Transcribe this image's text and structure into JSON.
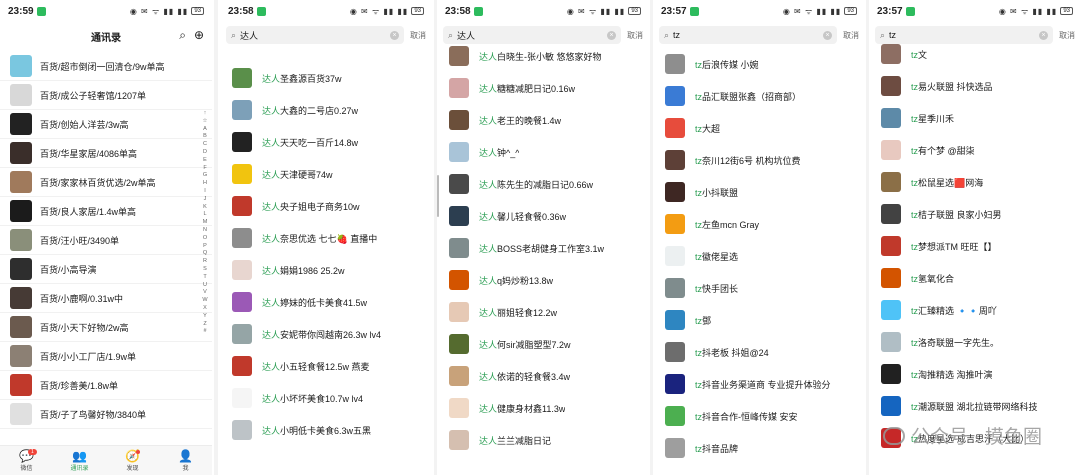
{
  "screens": [
    {
      "status": {
        "time": "23:59",
        "icons": "◉ ✉ ᯤ ▮▮ ▮▮",
        "battery": "93"
      },
      "header": {
        "title": "通讯录"
      },
      "rows": [
        {
          "label": "百货/超市倒闭一回清仓/9w单高",
          "color": "#7ac7e0"
        },
        {
          "label": "百货/成公子轻奢馆/1207单",
          "color": "#d8d8d8"
        },
        {
          "label": "百货/创始人洋芸/3w高",
          "color": "#222222"
        },
        {
          "label": "百货/华星家居/4086单高",
          "color": "#3a2e2a"
        },
        {
          "label": "百货/家家林百货优选/2w单高",
          "color": "#a07a5c"
        },
        {
          "label": "百货/良人家居/1.4w单高",
          "color": "#1b1b1b"
        },
        {
          "label": "百货/汪小旺/3490单",
          "color": "#8a8f7a"
        },
        {
          "label": "百货/小高导演",
          "color": "#2e2e2e"
        },
        {
          "label": "百货/小鹿啊/0.31w中",
          "color": "#463a35"
        },
        {
          "label": "百货/小天下好物/2w高",
          "color": "#6b5a4e"
        },
        {
          "label": "百货/小小工厂店/1.9w单",
          "color": "#8c8074"
        },
        {
          "label": "百货/珍善美/1.8w单",
          "color": "#c0392b"
        },
        {
          "label": "百货/子了鸟馨好物/3840单",
          "color": "#e0e0e0"
        }
      ],
      "alphabet": [
        "↑",
        "☆",
        "A",
        "B",
        "C",
        "D",
        "E",
        "F",
        "G",
        "H",
        "I",
        "J",
        "K",
        "L",
        "M",
        "N",
        "O",
        "P",
        "Q",
        "R",
        "S",
        "T",
        "U",
        "V",
        "W",
        "X",
        "Y",
        "Z",
        "#"
      ],
      "tabs": [
        {
          "label": "微信",
          "icon": "💬",
          "badge": "1"
        },
        {
          "label": "通讯录",
          "icon": "👥"
        },
        {
          "label": "发现",
          "icon": "🧭"
        },
        {
          "label": "我",
          "icon": "👤"
        }
      ]
    },
    {
      "status": {
        "time": "23:58",
        "icons": "◉ ✉ ᯤ ▮▮ ▮▮",
        "battery": "93"
      },
      "search": {
        "query": "达人",
        "cancel": "取消"
      },
      "rows": [
        {
          "hl": "达人",
          "rest": "圣鑫源百货37w",
          "color": "#5a8f4a"
        },
        {
          "hl": "达人",
          "rest": "大鑫的二号店0.27w",
          "color": "#7da0b8"
        },
        {
          "hl": "达人",
          "rest": "天天吃一百斤14.8w",
          "color": "#222222"
        },
        {
          "hl": "达人",
          "rest": "天津硬哥74w",
          "color": "#f1c40f"
        },
        {
          "hl": "达人",
          "rest": "央子姐电子商务10w",
          "color": "#c0392b"
        },
        {
          "hl": "达人",
          "rest": "奈思优选 七七🍓 直播中",
          "color": "#8d8d8d"
        },
        {
          "hl": "达人",
          "rest": "娟娟1986  25.2w",
          "color": "#e8d6d0"
        },
        {
          "hl": "达人",
          "rest": "婷妹的低卡美食41.5w",
          "color": "#9b59b6"
        },
        {
          "hl": "达人",
          "rest": "安妮带你闯越南26.3w  lv4",
          "color": "#95a5a6"
        },
        {
          "hl": "达人",
          "rest": "小五轻食餐12.5w 燕麦",
          "color": "#c0392b"
        },
        {
          "hl": "达人",
          "rest": "小坏坏美食10.7w lv4",
          "color": "#f5f5f5"
        },
        {
          "hl": "达人",
          "rest": "小明低卡美食6.3w五黑",
          "color": "#bdc3c7"
        }
      ]
    },
    {
      "status": {
        "time": "23:58",
        "icons": "◉ ✉ ᯤ ▮▮ ▮▮",
        "battery": "93"
      },
      "search": {
        "query": "达人",
        "cancel": "取消"
      },
      "rows": [
        {
          "hl": "达人",
          "rest": "白晓生-张小敏 悠悠家好物",
          "color": "#8a6d5a"
        },
        {
          "hl": "达人",
          "rest": "糖糖减肥日记0.16w",
          "color": "#d4a5a5"
        },
        {
          "hl": "达人",
          "rest": "老王的晚餐1.4w",
          "color": "#6b4f3a"
        },
        {
          "hl": "达人",
          "rest": "钟^_^",
          "color": "#a9c4d8"
        },
        {
          "hl": "达人",
          "rest": "陈先生的减脂日记0.66w",
          "color": "#4a4a4a"
        },
        {
          "hl": "达人",
          "rest": "馨儿轻食餐0.36w",
          "color": "#2c3e50"
        },
        {
          "hl": "达人",
          "rest": "BOSS老胡健身工作室3.1w",
          "color": "#7f8c8d"
        },
        {
          "hl": "达人",
          "rest": "q妈炒粉13.8w",
          "color": "#d35400"
        },
        {
          "hl": "达人",
          "rest": "丽姐轻食12.2w",
          "color": "#e6c9b5"
        },
        {
          "hl": "达人",
          "rest": "何sir减脂塑型7.2w",
          "color": "#556b2f"
        },
        {
          "hl": "达人",
          "rest": "依诺的轻食餐3.4w",
          "color": "#c8a27a"
        },
        {
          "hl": "达人",
          "rest": "健康身材鑫11.3w",
          "color": "#f0d9c6"
        },
        {
          "hl": "达人",
          "rest": "兰兰减脂日记",
          "color": "#d5bfb0"
        }
      ]
    },
    {
      "status": {
        "time": "23:57",
        "icons": "◉ ✉ ᯤ ▮▮ ▮▮",
        "battery": "93"
      },
      "search": {
        "query": "tz",
        "cancel": "取消"
      },
      "rows": [
        {
          "hl": "tz",
          "rest": "后浪传媒 小婉",
          "color": "#8e8e8e"
        },
        {
          "hl": "tz",
          "rest": "品汇联盟张鑫（招商部）",
          "color": "#3a7bd5"
        },
        {
          "hl": "tz",
          "rest": "大超",
          "color": "#e74c3c"
        },
        {
          "hl": "tz",
          "rest": "奈川12街6号  机构坑位费",
          "color": "#5d4037"
        },
        {
          "hl": "tz",
          "rest": "小抖联盟",
          "color": "#3e2723"
        },
        {
          "hl": "tz",
          "rest": "左鱼mcn Gray",
          "color": "#f39c12"
        },
        {
          "hl": "tz",
          "rest": "徽佬星选",
          "color": "#ecf0f1"
        },
        {
          "hl": "tz",
          "rest": "快手团长",
          "color": "#7f8c8d"
        },
        {
          "hl": "tz",
          "rest": "鄧",
          "color": "#2e86c1"
        },
        {
          "hl": "tz",
          "rest": "抖老板  抖姐@24",
          "color": "#6d6d6d"
        },
        {
          "hl": "tz",
          "rest": "抖音业务渠道商  专业提升体验分",
          "color": "#1a237e"
        },
        {
          "hl": "tz",
          "rest": "抖音合作-恒峰传媒 安安",
          "color": "#4caf50"
        },
        {
          "hl": "tz",
          "rest": "抖音品牌",
          "color": "#9e9e9e"
        }
      ]
    },
    {
      "status": {
        "time": "23:57",
        "icons": "◉ ✉ ᯤ ▮▮ ▮▮",
        "battery": "93"
      },
      "search": {
        "query": "tz",
        "cancel": "取消"
      },
      "rows": [
        {
          "hl": "tz",
          "rest": "文",
          "color": "#8d6e63"
        },
        {
          "hl": "tz",
          "rest": "易火联盟 抖快选品",
          "color": "#6d4c41"
        },
        {
          "hl": "tz",
          "rest": "星季川禾",
          "color": "#5d8aa8"
        },
        {
          "hl": "tz",
          "rest": "有个梦 @甜柒",
          "color": "#e8c9c0"
        },
        {
          "hl": "tz",
          "rest": "松鼠星选🟥网海",
          "color": "#8b6f47"
        },
        {
          "hl": "tz",
          "rest": "桔子联盟 良家小妇男",
          "color": "#424242"
        },
        {
          "hl": "tz",
          "rest": "梦想派TM 旺旺【】",
          "color": "#c0392b"
        },
        {
          "hl": "tz",
          "rest": "氢氧化合",
          "color": "#d35400"
        },
        {
          "hl": "tz",
          "rest": "汇臻精选 🔹🔹周吖",
          "color": "#4fc3f7"
        },
        {
          "hl": "tz",
          "rest": "洛奇联盟一字先生。",
          "color": "#b0bec5"
        },
        {
          "hl": "tz",
          "rest": "淘推精选 淘推叶演",
          "color": "#212121"
        },
        {
          "hl": "tz",
          "rest": "潮源联盟 湖北拉链带网络科技",
          "color": "#1565c0"
        },
        {
          "hl": "tz",
          "rest": "热度星选-成吉思汗（大比）",
          "color": "#c62828"
        }
      ]
    }
  ],
  "watermark": {
    "text": "公众号 · 摸鱼圈"
  }
}
